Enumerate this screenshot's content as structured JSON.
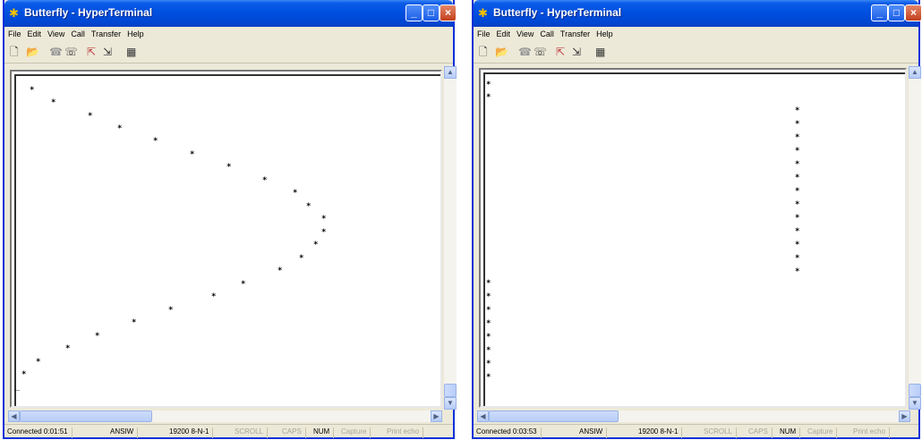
{
  "windows": [
    {
      "title": "Butterfly - HyperTerminal",
      "menu": [
        "File",
        "Edit",
        "View",
        "Call",
        "Transfer",
        "Help"
      ],
      "terminal_char": "*",
      "cursor_char": "_",
      "status": {
        "connected": "Connected 0:01:51",
        "emulation": "ANSIW",
        "settings": "19200 8-N-1",
        "scroll": "SCROLL",
        "caps": "CAPS",
        "num": "NUM",
        "capture": "Capture",
        "print_echo": "Print echo"
      }
    },
    {
      "title": "Butterfly - HyperTerminal",
      "menu": [
        "File",
        "Edit",
        "View",
        "Call",
        "Transfer",
        "Help"
      ],
      "terminal_char": "*",
      "status": {
        "connected": "Connected 0:03:53",
        "emulation": "ANSIW",
        "settings": "19200 8-N-1",
        "scroll": "SCROLL",
        "caps": "CAPS",
        "num": "NUM",
        "capture": "Capture",
        "print_echo": "Print echo"
      }
    }
  ],
  "toolbar_icons": [
    "new-icon",
    "open-icon",
    "disconnect-icon",
    "connect-icon",
    "send-icon",
    "receive-icon",
    "properties-icon"
  ],
  "colors": {
    "titlebar": "#0054e3",
    "close_button": "#c3401b",
    "window_face": "#ece9d8",
    "terminal_bg": "#ffffff"
  }
}
